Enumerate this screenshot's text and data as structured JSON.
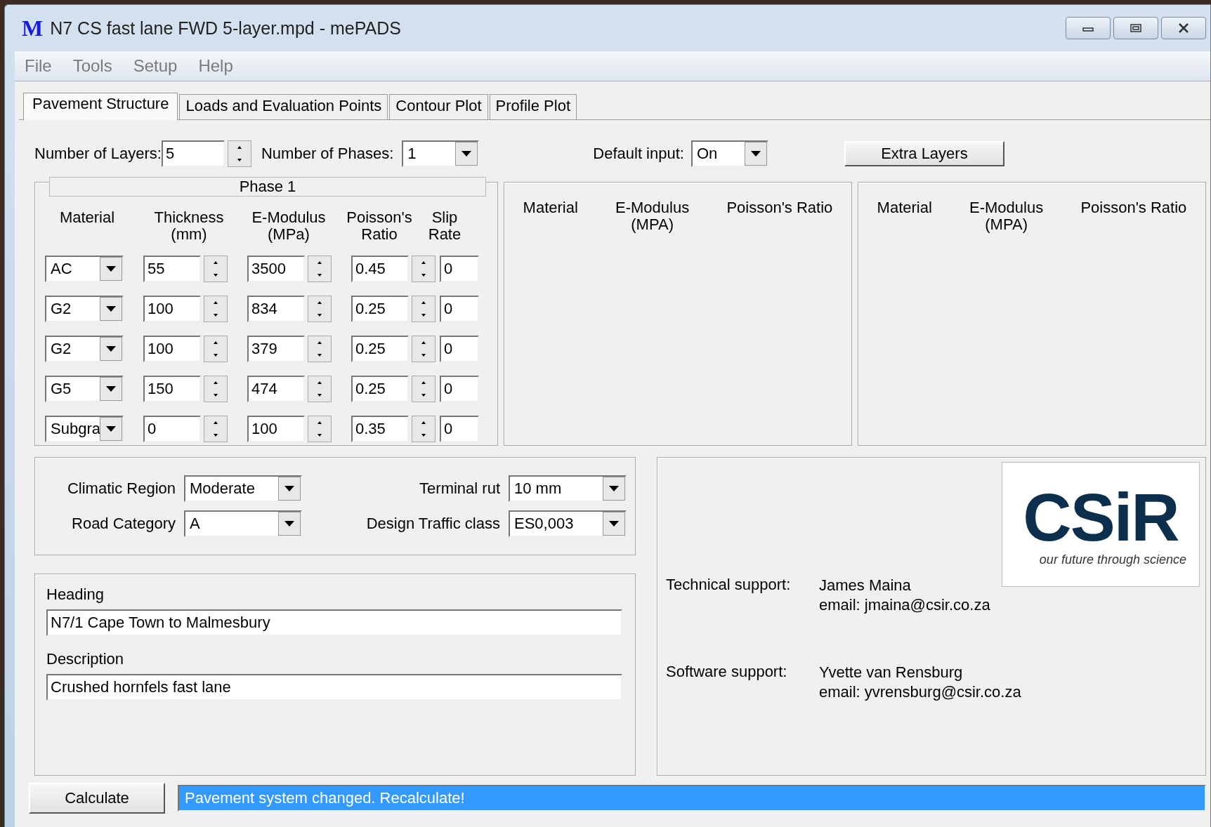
{
  "window": {
    "app_icon": "M",
    "title": "N7 CS fast lane FWD 5-layer.mpd - mePADS"
  },
  "menu": [
    "File",
    "Tools",
    "Setup",
    "Help"
  ],
  "tabs": [
    {
      "label": "Pavement Structure",
      "selected": true
    },
    {
      "label": "Loads and Evaluation Points",
      "selected": false
    },
    {
      "label": "Contour Plot",
      "selected": false
    },
    {
      "label": "Profile Plot",
      "selected": false
    }
  ],
  "top_controls": {
    "layers_label": "Number of Layers:",
    "layers_value": "5",
    "phases_label": "Number of Phases:",
    "phases_value": "1",
    "default_input_label": "Default input:",
    "default_input_value": "On",
    "extra_layers_button": "Extra Layers"
  },
  "phase_group": {
    "title": "Phase 1",
    "columns": [
      "Material",
      "Thickness\n(mm)",
      "E-Modulus\n(MPa)",
      "Poisson's\nRatio",
      "Slip\nRate"
    ],
    "layers": [
      {
        "material": "AC",
        "thickness": "55",
        "modulus": "3500",
        "poisson": "0.45",
        "slip": "0"
      },
      {
        "material": "G2",
        "thickness": "100",
        "modulus": "834",
        "poisson": "0.25",
        "slip": "0"
      },
      {
        "material": "G2",
        "thickness": "100",
        "modulus": "379",
        "poisson": "0.25",
        "slip": "0"
      },
      {
        "material": "G5",
        "thickness": "150",
        "modulus": "474",
        "poisson": "0.25",
        "slip": "0"
      },
      {
        "material": "Subgra",
        "thickness": "0",
        "modulus": "100",
        "poisson": "0.35",
        "slip": "0"
      }
    ]
  },
  "extra_panels": [
    {
      "columns": [
        "Material",
        "E-Modulus\n(MPA)",
        "Poisson's Ratio"
      ]
    },
    {
      "columns": [
        "Material",
        "E-Modulus\n(MPA)",
        "Poisson's Ratio"
      ]
    }
  ],
  "design": {
    "climatic_region_label": "Climatic Region",
    "climatic_region": "Moderate",
    "terminal_rut_label": "Terminal rut",
    "terminal_rut": "10 mm",
    "road_category_label": "Road Category",
    "road_category": "A",
    "traffic_class_label": "Design Traffic class",
    "traffic_class": "ES0,003"
  },
  "details": {
    "heading_label": "Heading",
    "heading": "N7/1 Cape Town to Malmesbury",
    "description_label": "Description",
    "description": "Crushed hornfels fast lane"
  },
  "support": {
    "logo": {
      "text": "CSiR",
      "tagline": "our future through science"
    },
    "contacts": [
      {
        "label": "Technical support:",
        "name": "James Maina",
        "email": "email: jmaina@csir.co.za"
      },
      {
        "label": "Software support:",
        "name": "Yvette van Rensburg",
        "email": "email: yvrensburg@csir.co.za"
      }
    ]
  },
  "calculate_button": "Calculate",
  "status": "Pavement system changed. Recalculate!"
}
